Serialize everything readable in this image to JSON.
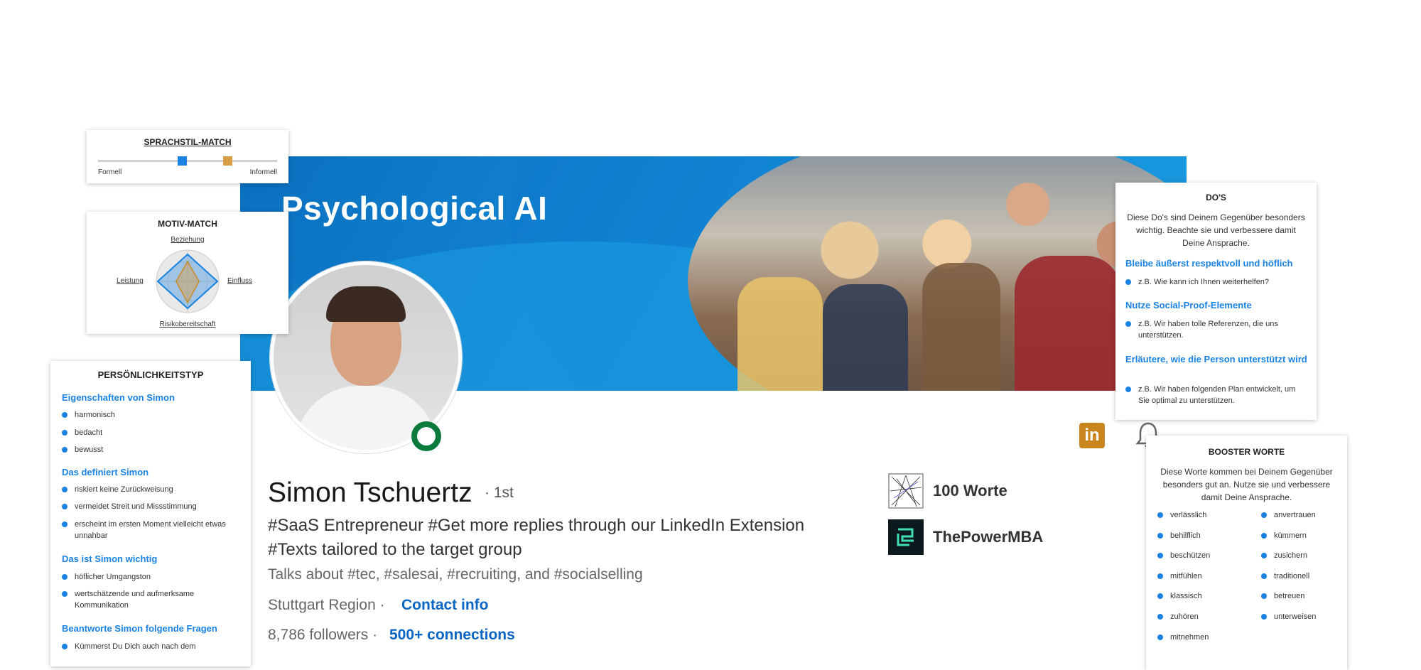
{
  "banner": {
    "title": "Psychological AI"
  },
  "profile": {
    "name": "Simon Tschuertz",
    "degree": "· 1st",
    "headline_line1": "#SaaS Entrepreneur #Get more replies through our LinkedIn Extension",
    "headline_line2": "#Texts tailored to the target group",
    "talks": "Talks about #tec, #salesai, #recruiting, and #socialselling",
    "location": "Stuttgart Region ·",
    "contact": "Contact info",
    "followers": "8,786 followers ·",
    "connections": "500+ connections"
  },
  "companies": [
    {
      "name": "100 Worte",
      "icon": "100-worte-logo"
    },
    {
      "name": "ThePowerMBA",
      "icon": "thepowermba-logo"
    }
  ],
  "icons": {
    "linkedin": "linkedin-icon",
    "bell": "bell-icon",
    "linkedin_text": "in"
  },
  "sprachstil": {
    "title": "SPRACHSTIL-MATCH",
    "left_label": "Formell",
    "right_label": "Informell",
    "marker_colors": [
      "#1a82e2",
      "#d79e45"
    ]
  },
  "motiv": {
    "title": "MOTIV-MATCH",
    "axes": {
      "top": "Beziehung",
      "left": "Leistung",
      "right": "Einfluss",
      "bottom": "Risikobereitschaft"
    }
  },
  "persoenlich": {
    "title": "PERSÖNLICHKEITSTYP",
    "sections": [
      {
        "heading": "Eigenschaften von Simon",
        "items": [
          "harmonisch",
          "bedacht",
          "bewusst"
        ]
      },
      {
        "heading": "Das definiert Simon",
        "items": [
          "riskiert keine Zurückweisung",
          "vermeidet Streit und Missstimmung",
          "erscheint im ersten Moment vielleicht etwas unnahbar"
        ]
      },
      {
        "heading": "Das ist Simon wichtig",
        "items": [
          "höflicher Umgangston",
          "wertschätzende und aufmerksame Kommunikation"
        ]
      },
      {
        "heading": "Beantworte Simon folgende Fragen",
        "items": [
          "Kümmerst Du Dich auch nach dem"
        ]
      }
    ]
  },
  "dos": {
    "title": "DO'S",
    "intro": "Diese Do's sind Deinem Gegenüber besonders wichtig. Beachte sie und verbessere damit Deine Ansprache.",
    "items": [
      {
        "heading": "Bleibe äußerst respektvoll und höflich",
        "example": "z.B. Wie kann ich Ihnen weiterhelfen?"
      },
      {
        "heading": "Nutze Social-Proof-Elemente",
        "example": "z.B. Wir haben tolle Referenzen, die uns unterstützen."
      },
      {
        "heading": "Erläutere, wie die Person unterstützt wird",
        "example": "z.B. Wir haben folgenden Plan entwickelt, um Sie optimal zu unterstützen."
      }
    ]
  },
  "booster": {
    "title": "BOOSTER WORTE",
    "intro": "Diese Worte kommen bei Deinem Gegenüber besonders gut an. Nutze sie und verbessere damit Deine Ansprache.",
    "col1": [
      "verlässlich",
      "behilflich",
      "beschützen",
      "mitfühlen",
      "klassisch",
      "zuhören",
      "mitnehmen"
    ],
    "col2": [
      "anvertrauen",
      "kümmern",
      "zusichern",
      "traditionell",
      "betreuen",
      "unterweisen"
    ]
  }
}
